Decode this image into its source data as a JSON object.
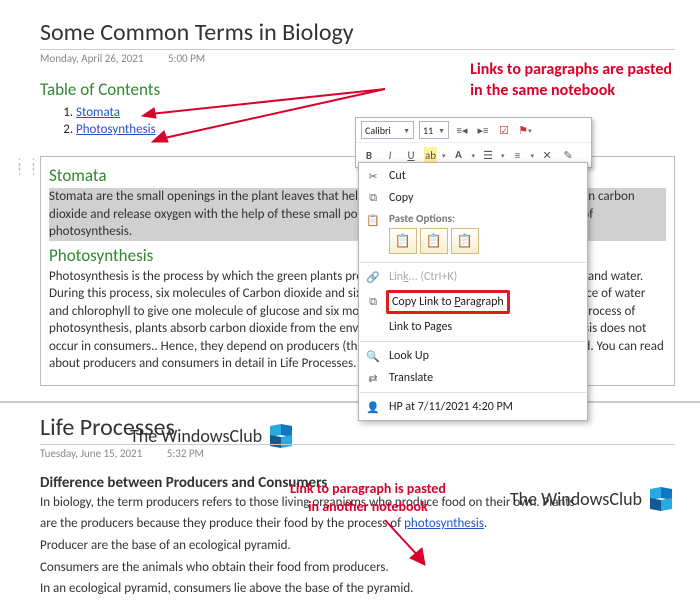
{
  "page1": {
    "title": "Some Common Terms in Biology",
    "date": "Monday, April 26, 2021",
    "time": "5:00 PM",
    "toc_head": "Table of Contents",
    "toc": [
      "Stomata",
      "Photosynthesis"
    ],
    "h1": "Stomata",
    "p1": "Stomata are the small openings in the plant leaves that help in the exchange of gases. The plants take in carbon dioxide and release oxygen with the help of these small pores. Stomata also takes part in the process of photosynthesis.",
    "h2": "Photosynthesis",
    "p2": "Photosynthesis is the process by which the green plants prepare their food in the presence of sunlight and water. During this process, six molecules of Carbon dioxide and six molecules of water combine in the presence of water and chlorophyll to give one molecule of glucose and six molecules of oxygen as the byproduct. In the process of photosynthesis, plants absorb carbon dioxide from the environment and release oxygen. Photosynthesis does not occur in consumers.. Hence, they depend on producers (the green food producers) to obtain their food. You can read about producers and consumers in detail in Life Processes."
  },
  "annotation1": "Links to paragraphs are pasted\nin the same notebook",
  "annotation2": "Link to paragraph is pasted\nin another notebook",
  "toolbar": {
    "font": "Calibri",
    "size": "11"
  },
  "context_menu": {
    "cut": "Cut",
    "copy": "Copy",
    "paste_options": "Paste Options:",
    "link": "Link...   (Ctrl+K)",
    "copy_link_para": "Copy Link to Paragraph",
    "link_pages": "Link to Pages",
    "lookup": "Look Up",
    "translate": "Translate",
    "footer": "HP at 7/11/2021 4:20 PM"
  },
  "logo_text": "The\nWindowsClub",
  "page2": {
    "title": "Life Processes",
    "date": "Tuesday, June 15, 2021",
    "time": "5:32 PM",
    "subhead": "Difference between Producers and Consumers",
    "l1a": "In biology, the term producers refers to those living organisms who produce food on their own. Plants",
    "l1b": "are the producers because they produce their food by the process of ",
    "l1c": "photosynthesis",
    "l1d": ".",
    "l2": "Producer are the base of an ecological pyramid.",
    "l3": "Consumers are the animals who obtain their food from producers.",
    "l4": "In an ecological pyramid, consumers lie above the base of the pyramid."
  }
}
